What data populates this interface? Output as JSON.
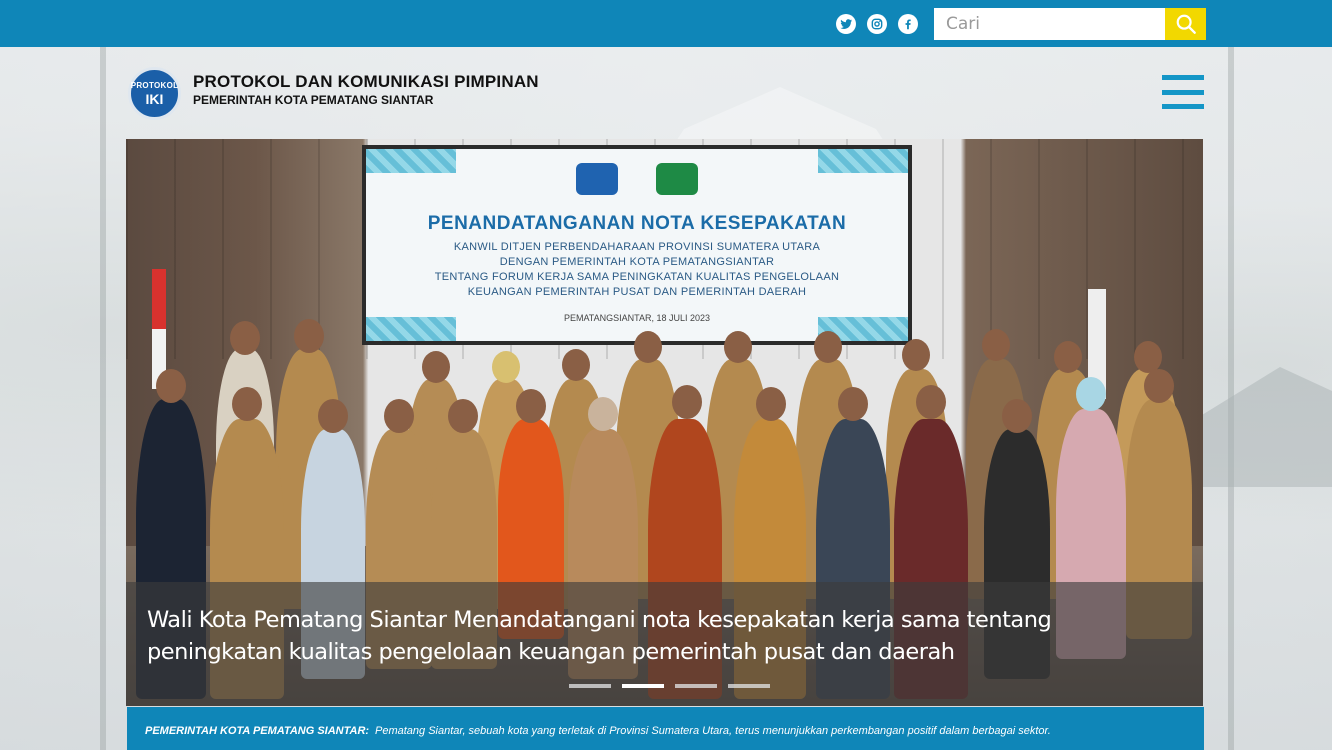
{
  "topbar": {
    "social": [
      "twitter-icon",
      "instagram-icon",
      "facebook-icon"
    ],
    "search": {
      "placeholder": "Cari",
      "value": ""
    },
    "accent": "#0f86b8",
    "search_button_color": "#f2d800"
  },
  "header": {
    "logo_text": "PROTOKOL",
    "logo_mark": "IKI",
    "title": "PROTOKOL DAN KOMUNIKASI PIMPINAN",
    "subtitle": "PEMERINTAH KOTA PEMATANG SIANTAR"
  },
  "slider": {
    "screen": {
      "title": "PENANDATANGANAN NOTA KESEPAKATAN",
      "lines": [
        "KANWIL DITJEN PERBENDAHARAAN PROVINSI SUMATERA UTARA",
        "DENGAN PEMERINTAH KOTA PEMATANGSIANTAR",
        "TENTANG FORUM KERJA SAMA PENINGKATAN KUALITAS PENGELOLAAN",
        "KEUANGAN PEMERINTAH PUSAT DAN PEMERINTAH DAERAH"
      ],
      "date": "PEMATANGSIANTAR, 18 JULI 2023"
    },
    "caption": "Wali Kota Pematang Siantar Menandatangani  nota kesepakatan kerja  sama tentang peningkatan kualitas pengelolaan keuangan pemerintah pusat dan daerah",
    "slide_count": 4,
    "active_slide": 2
  },
  "ticker": {
    "label": "PEMERINTAH KOTA PEMATANG SIANTAR:",
    "text": "Pematang Siantar, sebuah kota yang terletak di Provinsi Sumatera Utara, terus menunjukkan perkembangan positif dalam berbagai sektor."
  }
}
